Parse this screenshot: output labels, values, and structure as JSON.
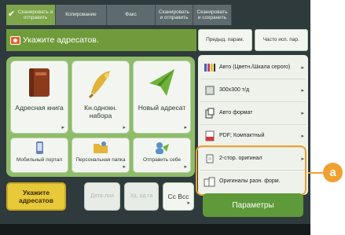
{
  "tabs": [
    {
      "label": "Сканировать и отправить",
      "active": true
    },
    {
      "label": "Копирование",
      "active": false
    },
    {
      "label": "Факс",
      "active": false
    },
    {
      "label": "Сканировать и отправить",
      "active": false
    },
    {
      "label": "Сканировать и сохранить",
      "active": false
    }
  ],
  "header": {
    "title": "Укажите адресатов."
  },
  "address_buttons": [
    {
      "label": "Адресная книга",
      "icon": "address-book-icon"
    },
    {
      "label": "Кн.однокн. набора",
      "icon": "one-touch-icon"
    },
    {
      "label": "Новый адресат",
      "icon": "paper-plane-icon"
    }
  ],
  "small_buttons": [
    {
      "label": "Мобильный портал",
      "icon": "mobile-portal-icon"
    },
    {
      "label": "Персональная папка",
      "icon": "personal-folder-icon"
    },
    {
      "label": "Отправить себе",
      "icon": "send-to-myself-icon"
    }
  ],
  "bottom_buttons": {
    "specify_destinations": "Укажите адресатов",
    "to": "Дата-лиа",
    "cc_bcc_disabled": "Уд. ад-га",
    "cc_bcc": "Cc Bcc"
  },
  "right_panel": {
    "prev_settings": "Предыд. парам.",
    "favorites": "Часто исп. пар.",
    "settings": [
      {
        "label": "Авто (Цветн./Шкала серого)",
        "icon": "color-mode-icon"
      },
      {
        "label": "300x300 т/д",
        "icon": "resolution-icon"
      },
      {
        "label": "Авто формат",
        "icon": "scan-size-icon"
      },
      {
        "label": "PDF; Компактный",
        "icon": "file-format-icon"
      },
      {
        "label": "2-стор. оригинал",
        "icon": "two-sided-icon"
      },
      {
        "label": "Оригиналы разн. форм.",
        "icon": "mixed-size-icon"
      }
    ],
    "options": "Параметры"
  },
  "callout": {
    "label": "a",
    "color": "#f0a030"
  },
  "colors": {
    "accent": "#6f9b3a",
    "highlight": "#f0a030",
    "active_tab": "#7fa64a",
    "yellow_button": "#e7c93a"
  }
}
